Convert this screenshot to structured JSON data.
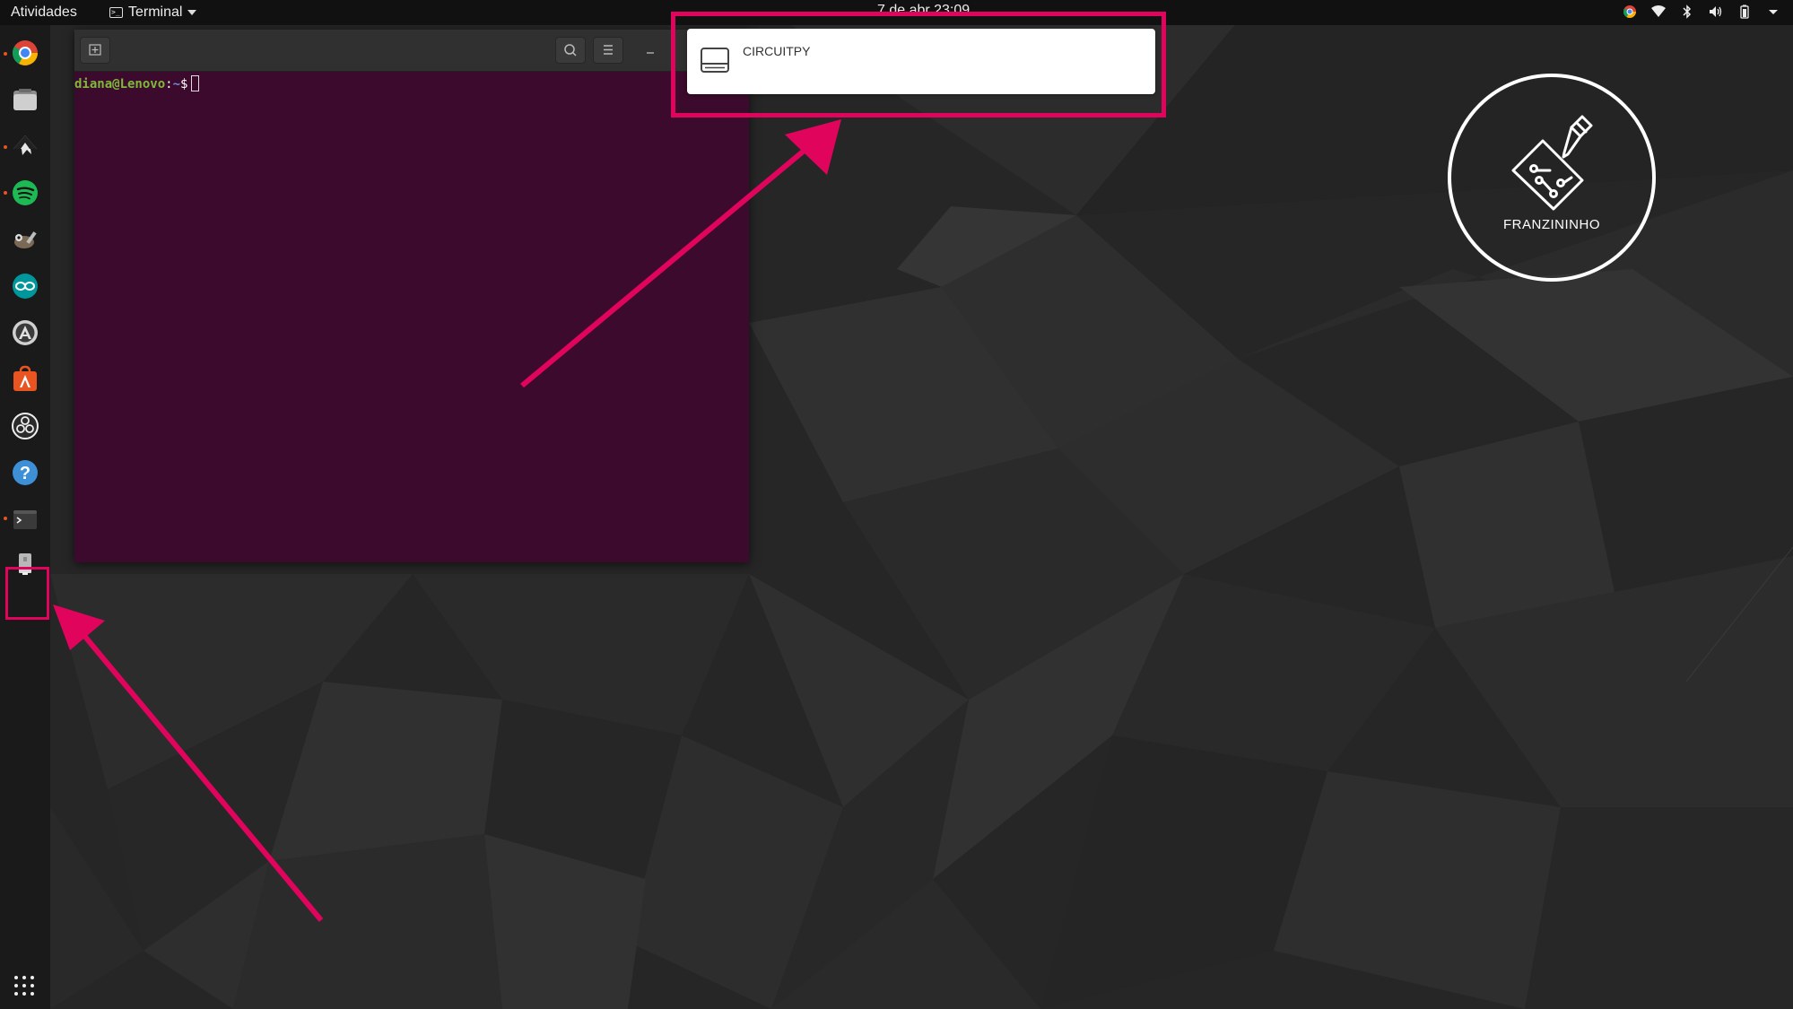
{
  "topbar": {
    "activities": "Atividades",
    "app_name": "Terminal",
    "clock": "7 de abr 23:09"
  },
  "dock": {
    "items": [
      {
        "name": "chrome-icon",
        "running": true
      },
      {
        "name": "files-icon",
        "running": false
      },
      {
        "name": "inkscape-icon",
        "running": true
      },
      {
        "name": "spotify-icon",
        "running": true
      },
      {
        "name": "gimp-icon",
        "running": false
      },
      {
        "name": "arduino-icon",
        "running": false
      },
      {
        "name": "software-updater-icon",
        "running": false
      },
      {
        "name": "ubuntu-software-icon",
        "running": false
      },
      {
        "name": "obs-icon",
        "running": false
      },
      {
        "name": "help-icon",
        "running": false
      },
      {
        "name": "terminal-icon",
        "running": true
      },
      {
        "name": "usb-drive-icon",
        "running": false
      }
    ],
    "show_apps": "apps-grid-icon"
  },
  "terminal": {
    "prompt_user": "diana@Lenovo",
    "prompt_sep": ":",
    "prompt_path": "~",
    "prompt_symbol": "$"
  },
  "notification": {
    "title": "CIRCUITPY",
    "icon": "drive-icon"
  },
  "logo": {
    "text": "FRANZININHO"
  },
  "colors": {
    "highlight": "#e0045c",
    "terminal_bg": "#3c0a2c",
    "accent": "#e95420"
  }
}
